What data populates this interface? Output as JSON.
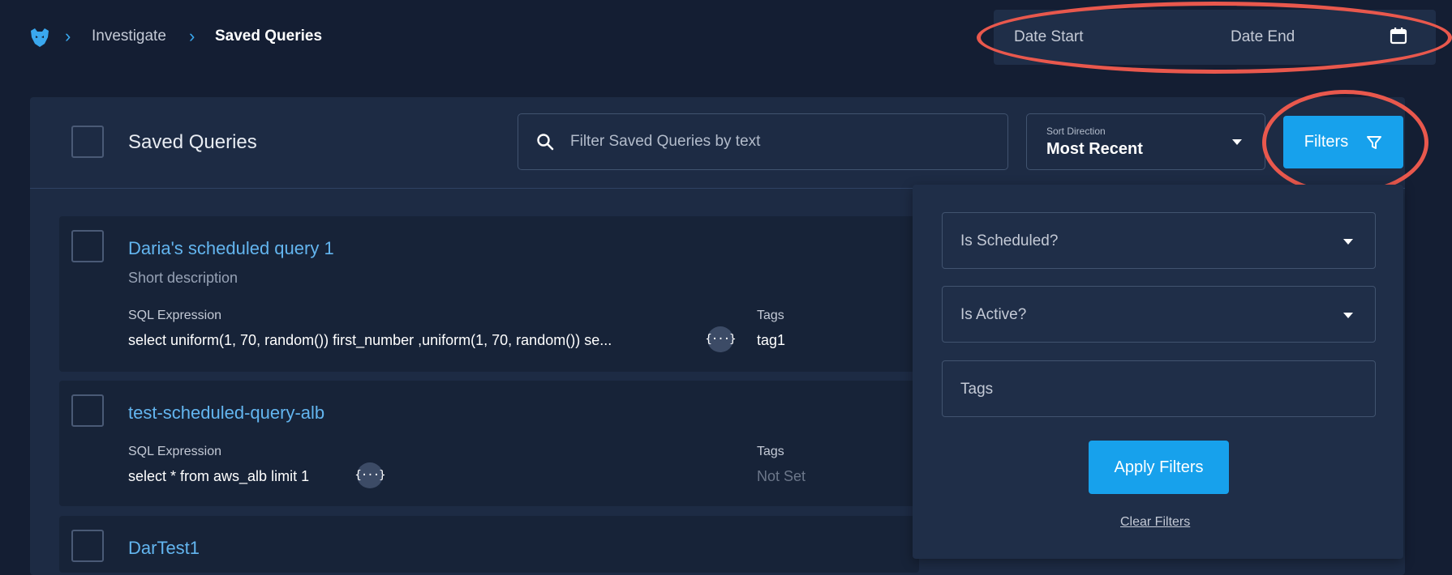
{
  "breadcrumb": {
    "items": [
      "Investigate",
      "Saved Queries"
    ]
  },
  "date_range": {
    "start_label": "Date Start",
    "end_label": "Date End"
  },
  "toolbar": {
    "title": "Saved Queries",
    "search_placeholder": "Filter Saved Queries by text",
    "sort_label": "Sort Direction",
    "sort_value": "Most Recent",
    "filters_label": "Filters"
  },
  "queries": [
    {
      "title": "Daria's scheduled query 1",
      "description": "Short description",
      "sql_label": "SQL Expression",
      "sql": "select uniform(1, 70, random()) first_number ,uniform(1, 70, random()) se...",
      "tags_label": "Tags",
      "tags": "tag1"
    },
    {
      "title": "test-scheduled-query-alb",
      "sql_label": "SQL Expression",
      "sql": "select * from aws_alb limit 1",
      "tags_label": "Tags",
      "tags": "Not Set"
    },
    {
      "title": "DarTest1"
    }
  ],
  "code_icon_glyph": "{···}",
  "filter_panel": {
    "is_scheduled": "Is Scheduled?",
    "is_active": "Is Active?",
    "tags": "Tags",
    "apply": "Apply Filters",
    "clear": "Clear Filters"
  },
  "colors": {
    "background": "#141e33",
    "panel": "#1d2b44",
    "accent": "#17a1ec",
    "link": "#63b5ef",
    "annotation": "#e9584d"
  },
  "icons": [
    "panther-logo-icon",
    "chevron-right-icon",
    "calendar-icon",
    "search-icon",
    "caret-down-icon",
    "funnel-icon",
    "code-icon"
  ]
}
